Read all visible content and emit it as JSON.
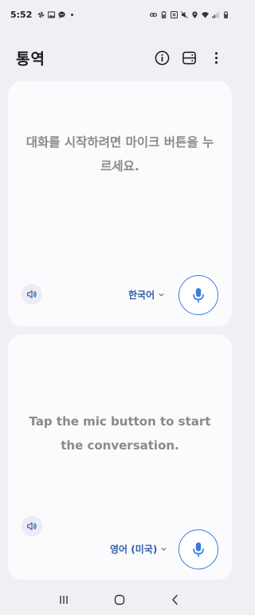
{
  "status_bar": {
    "time": "5:52",
    "left_icons": [
      "pinwheel-icon",
      "gallery-icon",
      "messenger-icon"
    ],
    "right_icons": [
      "link-icon",
      "battery-saver-icon",
      "nfc-icon",
      "mute-icon",
      "location-icon",
      "wifi-icon",
      "signal-icon",
      "battery-icon"
    ]
  },
  "header": {
    "title": "통역",
    "actions": [
      "info-icon",
      "layout-icon",
      "more-vert-icon"
    ]
  },
  "top_panel": {
    "prompt": "대화를 시작하려면 마이크 버튼을 누르세요.",
    "language": "한국어"
  },
  "bottom_panel": {
    "prompt": "Tap the mic button to start the conversation.",
    "language": "영어 (미국)"
  },
  "colors": {
    "accent": "#3a7be0",
    "language_text": "#2f5fa8",
    "prompt_text": "#8a8a8a",
    "background": "#f0f0f4",
    "panel": "#fbfbfd"
  },
  "nav_bar": {
    "buttons": [
      "recents-icon",
      "home-icon",
      "back-icon"
    ]
  }
}
